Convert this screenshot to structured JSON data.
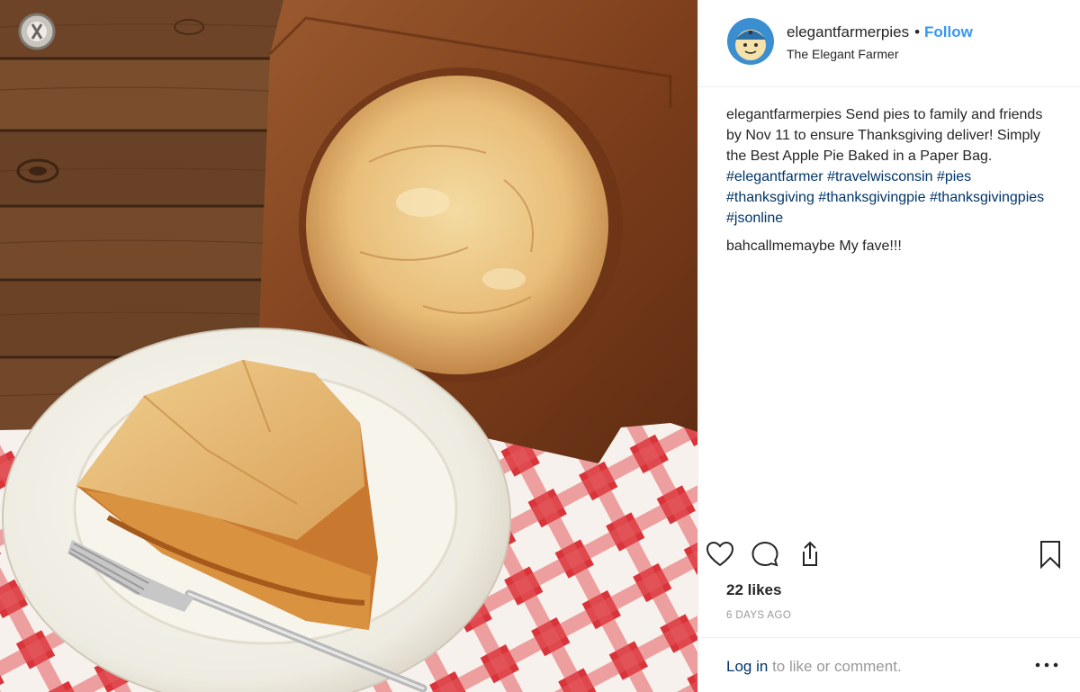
{
  "header": {
    "username": "elegantfarmerpies",
    "separator": "•",
    "follow_label": "Follow",
    "location": "The Elegant Farmer"
  },
  "caption": {
    "username": "elegantfarmerpies",
    "text": "Send pies to family and friends by Nov 11 to ensure Thanksgiving deliver! Simply the Best Apple Pie Baked in a Paper Bag.",
    "hashtags": [
      "#elegantfarmer",
      "#travelwisconsin",
      "#pies",
      "#thanksgiving",
      "#thanksgivingpie",
      "#thanksgivingpies",
      "#jsonline"
    ]
  },
  "comments": [
    {
      "username": "bahcallmemaybe",
      "text": "My fave!!!"
    }
  ],
  "actions": {
    "icons": [
      "heart-icon",
      "comment-icon",
      "share-icon",
      "bookmark-icon"
    ]
  },
  "likes": "22 likes",
  "timestamp": "6 DAYS AGO",
  "footer": {
    "login_link": "Log in",
    "login_text": "to like or comment.",
    "more_icon": "more-options-icon"
  },
  "colors": {
    "link_blue": "#3897f0",
    "hashtag_blue": "#003569",
    "muted_gray": "#999999",
    "text": "#262626",
    "checker_red": "#d9343a",
    "wood_brown": "#6b4327",
    "paper_bag": "#8a4a22"
  }
}
